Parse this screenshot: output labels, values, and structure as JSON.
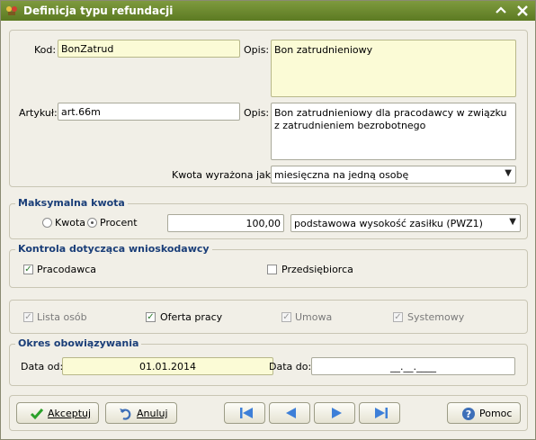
{
  "window": {
    "title": "Definicja typu refundacji"
  },
  "top": {
    "kod_label": "Kod:",
    "kod_value": "BonZatrud",
    "opis1_label": "Opis:",
    "opis1_value": "Bon zatrudnieniowy",
    "artykul_label": "Artykuł:",
    "artykul_value": "art.66m",
    "opis2_label": "Opis:",
    "opis2_value": "Bon zatrudnieniowy dla pracodawcy w związku z zatrudnieniem bezrobotnego",
    "kwota_label": "Kwota wyrażona jako:",
    "kwota_value": "miesięczna na jedną osobę"
  },
  "max_kwota": {
    "title": "Maksymalna kwota",
    "radio_kwota": "Kwota",
    "radio_procent": "Procent",
    "selected": "Procent",
    "value": "100,00",
    "base_value": "podstawowa wysokość zasiłku (PWZ1)"
  },
  "kontrola": {
    "title": "Kontrola dotycząca wnioskodawcy",
    "pracodawca": "Pracodawca",
    "pracodawca_checked": true,
    "przedsiebiorca": "Przedsiębiorca",
    "przedsiebiorca_checked": false
  },
  "flags": {
    "lista_osob": "Lista osób",
    "oferta_pracy": "Oferta pracy",
    "umowa": "Umowa",
    "systemowy": "Systemowy"
  },
  "okres": {
    "title": "Okres obowiązywania",
    "data_od_label": "Data od:",
    "data_od_value": "01.01.2014",
    "data_do_label": "Data do:",
    "data_do_value": "__.__.____"
  },
  "buttons": {
    "akceptuj": "Akceptuj",
    "anuluj": "Anuluj",
    "pomoc": "Pomoc"
  },
  "colors": {
    "title_bar": "#6b8a2e",
    "group_title": "#1a3e78",
    "nav_arrow": "#3d7fd8"
  }
}
